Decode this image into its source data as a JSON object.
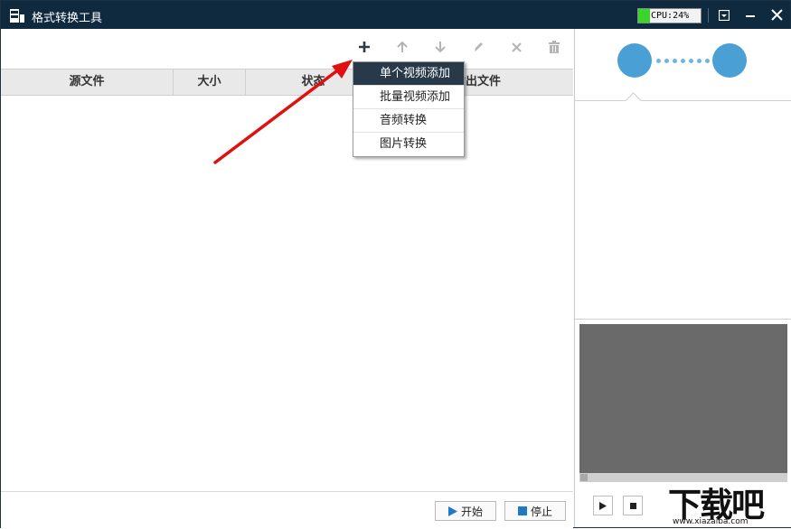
{
  "window": {
    "title": "格式转换工具",
    "cpu_label": "CPU:24%",
    "cpu_percent": 24,
    "buttons": {
      "menu": "▾",
      "minimize": "—",
      "close": "✕"
    }
  },
  "toolbar": {
    "icons": [
      "plus-icon",
      "arrow-up-icon",
      "arrow-down-icon",
      "pencil-icon",
      "close-icon",
      "trash-icon"
    ]
  },
  "table": {
    "columns": [
      "源文件",
      "大小",
      "状态",
      "输出文件"
    ]
  },
  "dropdown": {
    "items": [
      "单个视频添加",
      "批量视频添加",
      "音频转换",
      "图片转换"
    ],
    "active_index": 0
  },
  "footer": {
    "start_label": "开始",
    "stop_label": "停止"
  },
  "watermark": {
    "logo_text": "下载吧",
    "url_text": "www.xiazaiba.com"
  },
  "colors": {
    "titlebar": "#0f2a3f",
    "accent": "#4aa0d5",
    "menu_active": "#283a4a",
    "cpu_fill": "#39d52a",
    "arrow": "#e01010"
  }
}
